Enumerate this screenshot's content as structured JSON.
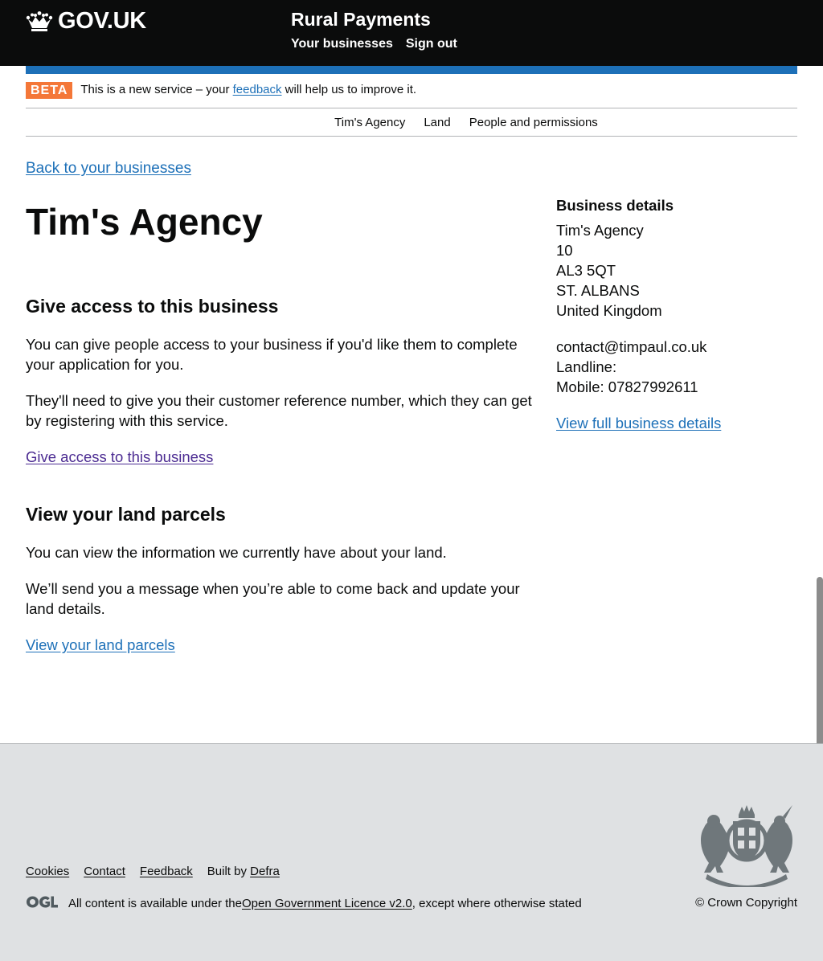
{
  "header": {
    "logo_text": "GOV.UK",
    "service_name": "Rural Payments",
    "nav": [
      "Your businesses",
      "Sign out"
    ]
  },
  "phase_banner": {
    "tag": "BETA",
    "text_before": "This is a new service – your ",
    "link": "feedback",
    "text_after": " will help us to improve it."
  },
  "subnav": [
    "Tim's Agency",
    "Land",
    "People and permissions"
  ],
  "back_link": "Back to your businesses",
  "page_title": "Tim's Agency",
  "access_section": {
    "heading": "Give access to this business",
    "para1": "You can give people access to your business if you'd like them to complete your application for you.",
    "para2": "They'll need to give you their customer reference number, which they can get by registering with this service.",
    "link": "Give access to this business"
  },
  "land_section": {
    "heading": "View your land parcels",
    "para1": "You can view the information we currently have about your land.",
    "para2": "We’ll send you a message when you’re able to come back and update your land details.",
    "link": "View your land parcels"
  },
  "business_details": {
    "heading": "Business details",
    "address": [
      "Tim's Agency",
      "10",
      "AL3 5QT",
      "ST. ALBANS",
      "United Kingdom"
    ],
    "email": "contact@timpaul.co.uk",
    "landline": "Landline:",
    "mobile": "Mobile: 07827992611",
    "link": "View full business details"
  },
  "footer": {
    "links": [
      "Cookies",
      "Contact",
      "Feedback"
    ],
    "built_by": "Built by ",
    "built_by_link": "Defra",
    "licence_before": "All content is available under the ",
    "licence_link": "Open Government Licence v2.0",
    "licence_after": ", except where otherwise stated",
    "copyright": "© Crown Copyright"
  },
  "colors": {
    "header_bg": "#0b0c0c",
    "brand_blue": "#1d70b8",
    "beta_orange": "#f47738",
    "visited_purple": "#4c2c92",
    "footer_bg": "#dfe1e3"
  },
  "icons": [
    "crown-icon",
    "ogl-logo-icon",
    "royal-coat-of-arms"
  ]
}
